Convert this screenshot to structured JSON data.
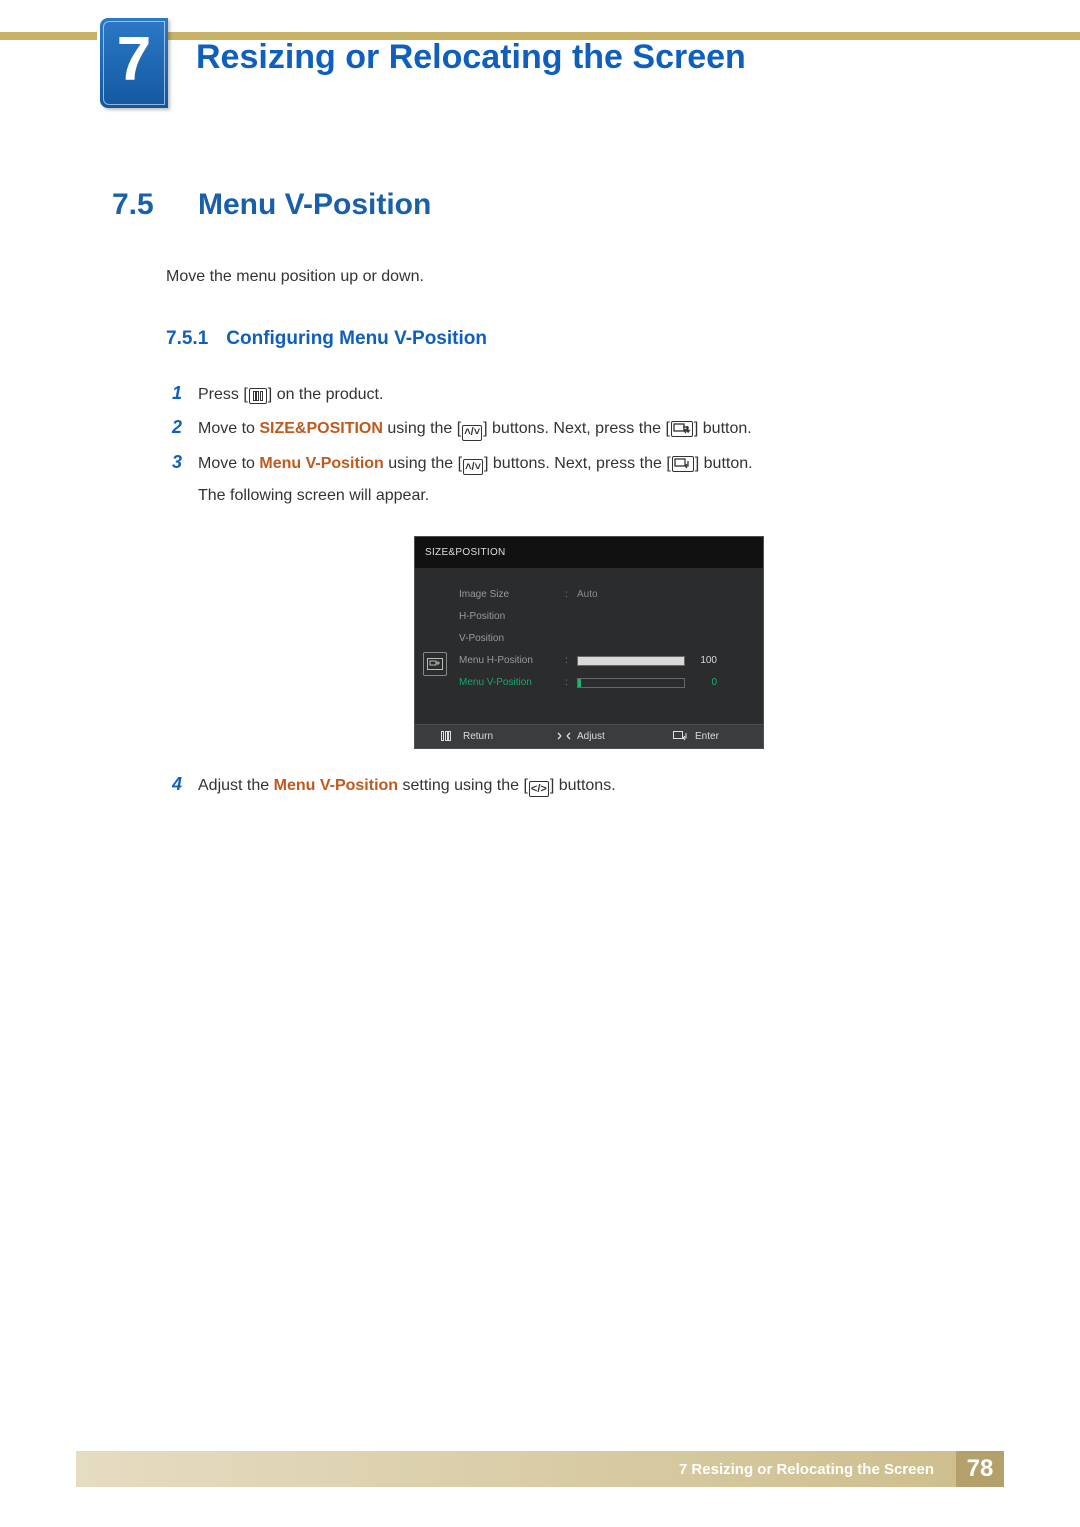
{
  "chapter": {
    "number": "7",
    "title": "Resizing or Relocating the Screen"
  },
  "section": {
    "number": "7.5",
    "title": "Menu V-Position",
    "intro": "Move the menu position up or down."
  },
  "subsection": {
    "number": "7.5.1",
    "title": "Configuring Menu V-Position"
  },
  "steps": {
    "s1": {
      "num": "1",
      "a": "Press [",
      "b": "] on the product."
    },
    "s2": {
      "num": "2",
      "a": "Move to ",
      "kw": "SIZE&POSITION",
      "b": " using the [",
      "c": "] buttons. Next, press the [",
      "d": "] button."
    },
    "s3": {
      "num": "3",
      "a": "Move to ",
      "kw": "Menu V-Position",
      "b": " using the [",
      "c": "] buttons. Next, press the [",
      "d": "] button.",
      "extra": "The following screen will appear."
    },
    "s4": {
      "num": "4",
      "a": "Adjust the ",
      "kw": "Menu V-Position",
      "b": " setting using the [",
      "c": "] buttons."
    }
  },
  "osd": {
    "title": "SIZE&POSITION",
    "rows": {
      "image_size": {
        "label": "Image Size",
        "value": "Auto"
      },
      "h_position": {
        "label": "H-Position"
      },
      "v_position": {
        "label": "V-Position"
      },
      "menu_h": {
        "label": "Menu H-Position",
        "value": "100",
        "fill": 100
      },
      "menu_v": {
        "label": "Menu V-Position",
        "value": "0",
        "fill": 3
      }
    },
    "footer": {
      "return": "Return",
      "adjust": "Adjust",
      "enter": "Enter"
    }
  },
  "footer": {
    "text": "7 Resizing or Relocating the Screen",
    "page": "78"
  }
}
